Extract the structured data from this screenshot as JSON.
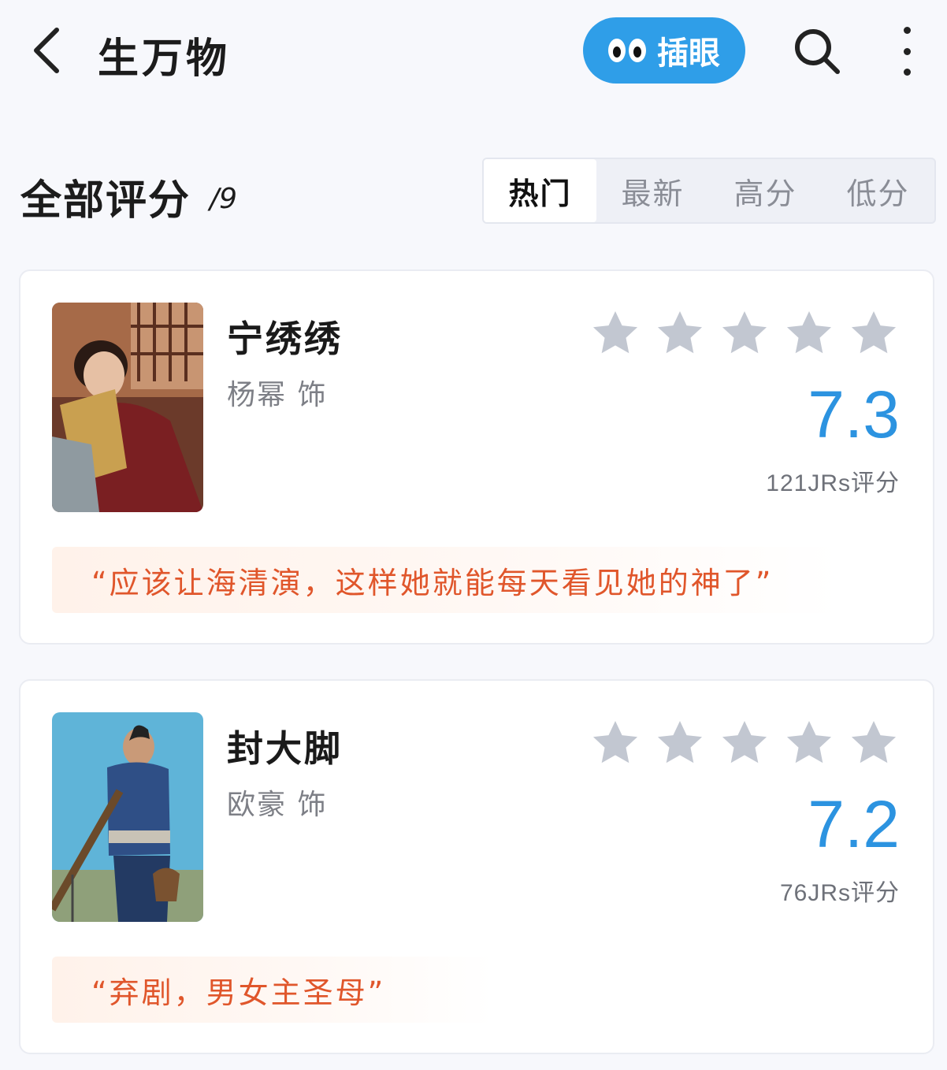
{
  "header": {
    "title": "生万物",
    "chayan_label": "插眼"
  },
  "section": {
    "title": "全部评分",
    "count": "/9",
    "tabs": [
      {
        "label": "热门",
        "active": true
      },
      {
        "label": "最新",
        "active": false
      },
      {
        "label": "高分",
        "active": false
      },
      {
        "label": "低分",
        "active": false
      }
    ]
  },
  "ratings": [
    {
      "name": "宁绣绣",
      "actor": "杨幂 饰",
      "score": "7.3",
      "count_text": "121JRs评分",
      "quote": "“应该让海清演，这样她就能每天看见她的神了”"
    },
    {
      "name": "封大脚",
      "actor": "欧豪 饰",
      "score": "7.2",
      "count_text": "76JRs评分",
      "quote": "“弃剧，男女主圣母”"
    }
  ],
  "colors": {
    "accent": "#2f9ee8",
    "score": "#2c93e0",
    "quote": "#e0562b",
    "star": "#c2c7d1"
  }
}
